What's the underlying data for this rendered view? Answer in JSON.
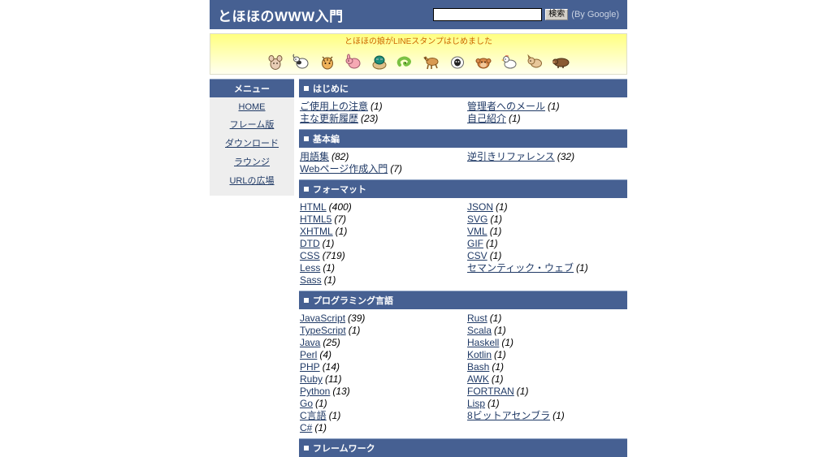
{
  "header": {
    "title": "とほほのWWW入門",
    "search": {
      "value": "",
      "placeholder": "",
      "button_label": "検索",
      "note": "(By Google)"
    }
  },
  "banner": {
    "text": "とほほの娘がLINEスタンプはじめました",
    "stickers": [
      {
        "name": "sticker-rat",
        "emoji": "🐭"
      },
      {
        "name": "sticker-ox",
        "emoji": "🐮"
      },
      {
        "name": "sticker-tiger",
        "emoji": "🐯"
      },
      {
        "name": "sticker-rabbit",
        "emoji": "🐷"
      },
      {
        "name": "sticker-dragon",
        "emoji": "🐲"
      },
      {
        "name": "sticker-snake",
        "emoji": "🐍"
      },
      {
        "name": "sticker-horse",
        "emoji": "🐕"
      },
      {
        "name": "sticker-sheep",
        "emoji": "🐄"
      },
      {
        "name": "sticker-monkey",
        "emoji": "🐵"
      },
      {
        "name": "sticker-rooster",
        "emoji": "🐔"
      },
      {
        "name": "sticker-dog",
        "emoji": "🐶"
      },
      {
        "name": "sticker-boar",
        "emoji": "🐗"
      }
    ]
  },
  "sidebar": {
    "header": "メニュー",
    "items": [
      {
        "label": "HOME"
      },
      {
        "label": "フレーム版"
      },
      {
        "label": "ダウンロード"
      },
      {
        "label": "ラウンジ"
      },
      {
        "label": "URLの広場"
      }
    ]
  },
  "sections": [
    {
      "title": "はじめに",
      "left": [
        {
          "label": "ご使用上の注意",
          "count": "(1)"
        },
        {
          "label": "主な更新履歴",
          "count": "(23)"
        }
      ],
      "right": [
        {
          "label": "管理者へのメール",
          "count": "(1)"
        },
        {
          "label": "自己紹介",
          "count": "(1)"
        }
      ]
    },
    {
      "title": "基本編",
      "left": [
        {
          "label": "用語集",
          "count": "(82)"
        },
        {
          "label": "Webページ作成入門",
          "count": "(7)"
        }
      ],
      "right": [
        {
          "label": "逆引きリファレンス",
          "count": "(32)"
        }
      ]
    },
    {
      "title": "フォーマット",
      "left": [
        {
          "label": "HTML",
          "count": "(400)"
        },
        {
          "label": "HTML5",
          "count": "(7)"
        },
        {
          "label": "XHTML",
          "count": "(1)"
        },
        {
          "label": "DTD",
          "count": "(1)"
        },
        {
          "label": "CSS",
          "count": "(719)"
        },
        {
          "label": "Less",
          "count": "(1)"
        },
        {
          "label": "Sass",
          "count": "(1)"
        }
      ],
      "right": [
        {
          "label": "JSON",
          "count": "(1)"
        },
        {
          "label": "SVG",
          "count": "(1)"
        },
        {
          "label": "VML",
          "count": "(1)"
        },
        {
          "label": "GIF",
          "count": "(1)"
        },
        {
          "label": "CSV",
          "count": "(1)"
        },
        {
          "label": "セマンティック・ウェブ",
          "count": "(1)"
        }
      ]
    },
    {
      "title": "プログラミング言語",
      "left": [
        {
          "label": "JavaScript",
          "count": "(39)"
        },
        {
          "label": "TypeScript",
          "count": "(1)"
        },
        {
          "label": "Java",
          "count": "(25)"
        },
        {
          "label": "Perl",
          "count": "(4)"
        },
        {
          "label": "PHP",
          "count": "(14)"
        },
        {
          "label": "Ruby",
          "count": "(11)"
        },
        {
          "label": "Python",
          "count": "(13)"
        },
        {
          "label": "Go",
          "count": "(1)"
        },
        {
          "label": "C言語",
          "count": "(1)"
        },
        {
          "label": "C#",
          "count": "(1)"
        }
      ],
      "right": [
        {
          "label": "Rust",
          "count": "(1)"
        },
        {
          "label": "Scala",
          "count": "(1)"
        },
        {
          "label": "Haskell",
          "count": "(1)"
        },
        {
          "label": "Kotlin",
          "count": "(1)"
        },
        {
          "label": "Bash",
          "count": "(1)"
        },
        {
          "label": "AWK",
          "count": "(1)"
        },
        {
          "label": "FORTRAN",
          "count": "(1)"
        },
        {
          "label": "Lisp",
          "count": "(1)"
        },
        {
          "label": "8ビットアセンブラ",
          "count": "(1)"
        }
      ]
    },
    {
      "title": "フレームワーク",
      "left": [],
      "right": []
    }
  ],
  "colors": {
    "brand_blue": "#466092",
    "link_navy": "#203a66",
    "sidebar_bg": "#eeeeee",
    "banner_yellow": "#ffff80",
    "banner_text": "#cc6600"
  }
}
